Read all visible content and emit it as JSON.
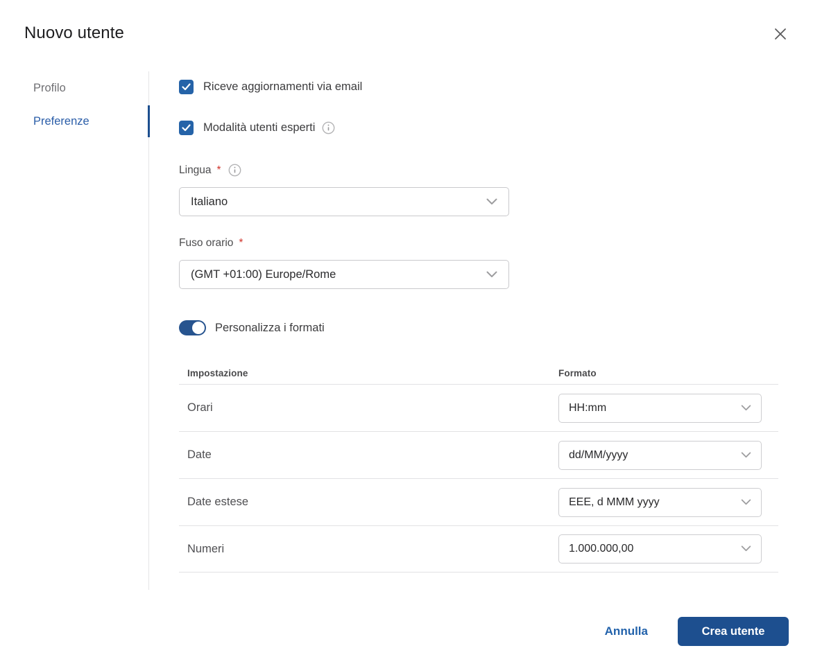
{
  "dialog": {
    "title": "Nuovo utente"
  },
  "sidebar": {
    "items": [
      {
        "label": "Profilo",
        "active": false
      },
      {
        "label": "Preferenze",
        "active": true
      }
    ]
  },
  "preferences": {
    "checkboxes": [
      {
        "label": "Riceve aggiornamenti via email",
        "checked": true,
        "has_info": false
      },
      {
        "label": "Modalità utenti esperti",
        "checked": true,
        "has_info": true
      }
    ],
    "language_field": {
      "label": "Lingua",
      "required_marker": "*",
      "value": "Italiano"
    },
    "timezone_field": {
      "label": "Fuso orario",
      "required_marker": "*",
      "value": "(GMT +01:00) Europe/Rome"
    },
    "toggle": {
      "label": "Personalizza i formati",
      "on": true
    },
    "formats_table": {
      "columns": {
        "setting": "Impostazione",
        "format": "Formato"
      },
      "rows": [
        {
          "setting": "Orari",
          "format": "HH:mm"
        },
        {
          "setting": "Date",
          "format": "dd/MM/yyyy"
        },
        {
          "setting": "Date estese",
          "format": "EEE, d MMM yyyy"
        },
        {
          "setting": "Numeri",
          "format": "1.000.000,00"
        }
      ]
    }
  },
  "footer": {
    "cancel_label": "Annulla",
    "submit_label": "Crea utente"
  },
  "colors": {
    "primary_button": "#1d4f8f",
    "checkbox_blue": "#2563a8",
    "toggle_blue": "#27548f",
    "active_tab_blue": "#2a5da8",
    "link_blue": "#2262ab",
    "required_red": "#d0342c",
    "divider_gray": "#e2e2e4"
  }
}
